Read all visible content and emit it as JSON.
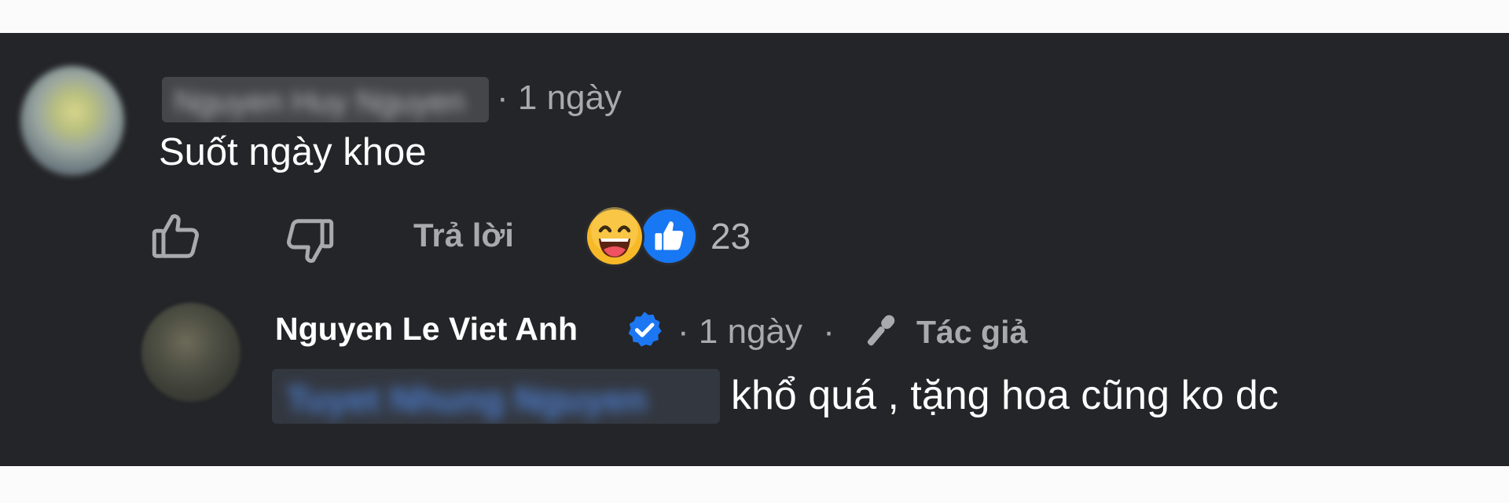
{
  "colors": {
    "panel_background": "#242528",
    "page_background": "#fbfbfb",
    "primary_text": "#ffffff",
    "secondary_text": "#a9aaad",
    "facebook_blue": "#1877f2",
    "haha_yellow": "#f7b928",
    "verified_blue": "#1d77f2"
  },
  "comment": {
    "avatar_icon": "user-avatar",
    "author_name_blurred": "Nguyen Huy Nguyen",
    "time": "· 1 ngày",
    "text": "Suốt ngày khoe",
    "actions": {
      "like_icon": "thumbs-up-outline-icon",
      "dislike_icon": "thumbs-down-outline-icon",
      "reply_label": "Trả lời"
    },
    "reactions": {
      "icons": [
        "haha-emoji-icon",
        "like-reaction-icon"
      ],
      "count": "23"
    }
  },
  "reply": {
    "avatar_icon": "user-avatar",
    "author_name": "Nguyen Le Viet Anh",
    "verified_icon": "verified-badge-icon",
    "time": "· 1 ngày",
    "separator": "·",
    "author_tag_icon": "microphone-icon",
    "author_tag": "Tác giả",
    "mention_blurred": "Tuyet Nhung Nguyen",
    "text": "khổ quá , tặng hoa cũng ko dc"
  }
}
